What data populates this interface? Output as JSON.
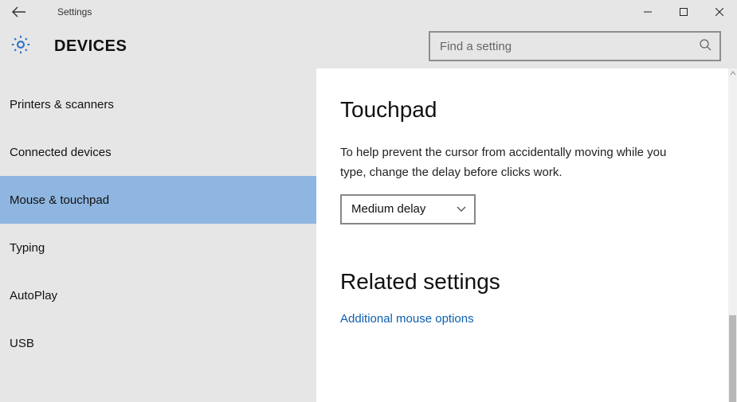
{
  "window": {
    "title": "Settings"
  },
  "header": {
    "category": "DEVICES",
    "search_placeholder": "Find a setting"
  },
  "sidebar": {
    "items": [
      {
        "label": "Printers & scanners",
        "selected": false
      },
      {
        "label": "Connected devices",
        "selected": false
      },
      {
        "label": "Mouse & touchpad",
        "selected": true
      },
      {
        "label": "Typing",
        "selected": false
      },
      {
        "label": "AutoPlay",
        "selected": false
      },
      {
        "label": "USB",
        "selected": false
      }
    ]
  },
  "content": {
    "section_title": "Touchpad",
    "description": "To help prevent the cursor from accidentally moving while you type, change the delay before clicks work.",
    "delay_dropdown": {
      "selected": "Medium delay"
    },
    "related_title": "Related settings",
    "related_link": "Additional mouse options"
  }
}
